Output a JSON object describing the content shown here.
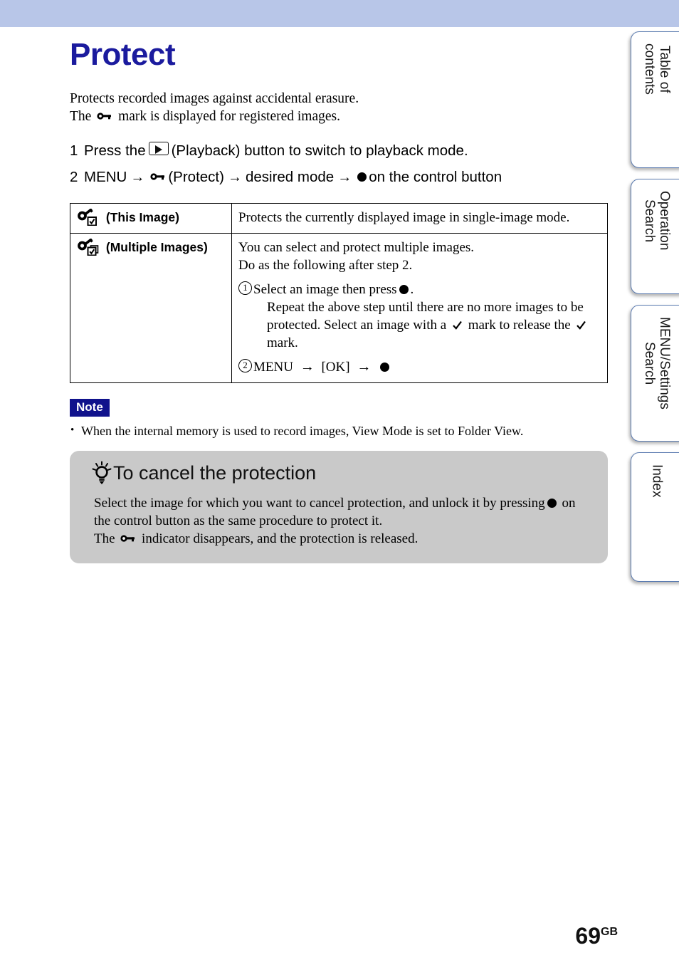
{
  "page": {
    "title": "Protect",
    "number": "69",
    "number_suffix": "GB",
    "banner_color": "#b8c6e8",
    "title_color": "#1b1b9e"
  },
  "intro": {
    "line1": "Protects recorded images against accidental erasure.",
    "line2_before": "The",
    "line2_icon": "key-icon",
    "line2_after": "mark is displayed for registered images."
  },
  "steps": [
    {
      "number": "1",
      "before_icon": "Press the",
      "icon": "playback-button-icon",
      "after_icon": "(Playback) button to switch to playback mode."
    },
    {
      "number": "2",
      "menu_label": "MENU",
      "arrow": "→",
      "icon": "key-icon",
      "protect_label": "(Protect)",
      "desired_mode_label": "desired mode",
      "control_button_label": "on the control button"
    }
  ],
  "table": {
    "rows": [
      {
        "icon": "key-checkbox-single-icon",
        "mode_label": "(This Image)",
        "description_lines": [
          "Protects the currently displayed image in single-image mode."
        ]
      },
      {
        "icon": "key-checkbox-multiple-icon",
        "mode_label": "(Multiple Images)",
        "description_lines": [
          "You can select and protect multiple images.",
          "Do as the following after step 2."
        ],
        "numbered_items": [
          {
            "number": "1",
            "main_before_dot": "Select an image then press",
            "main_after_dot": ".",
            "sub_part1": "Repeat the above step until there are no more images to be",
            "sub_part2": "protected. Select an image with a",
            "sub_part3": "mark to release the",
            "sub_part4": "mark."
          },
          {
            "number": "2",
            "menu_label": "MENU",
            "arrow": "→",
            "ok_label": "[OK]"
          }
        ]
      }
    ]
  },
  "note": {
    "badge": "Note",
    "items": [
      "When the internal memory is used to record images, View Mode is set to Folder View."
    ]
  },
  "tip": {
    "icon": "lightbulb-icon",
    "title": "To cancel the protection",
    "body_line1_before_dot": "Select the image for which you want to cancel protection, and unlock it by pressing",
    "body_line1_after_dot": "on",
    "body_line2": "the control button as the same procedure to protect it.",
    "body_line3_before_icon": "The",
    "body_line3_icon": "key-icon",
    "body_line3_after_icon": "indicator disappears, and the protection is released.",
    "background_color": "#c9c9c9"
  },
  "side_tabs": [
    {
      "label": "Table of\ncontents"
    },
    {
      "label": "Operation\nSearch"
    },
    {
      "label": "MENU/Settings\nSearch"
    },
    {
      "label": "Index"
    }
  ]
}
